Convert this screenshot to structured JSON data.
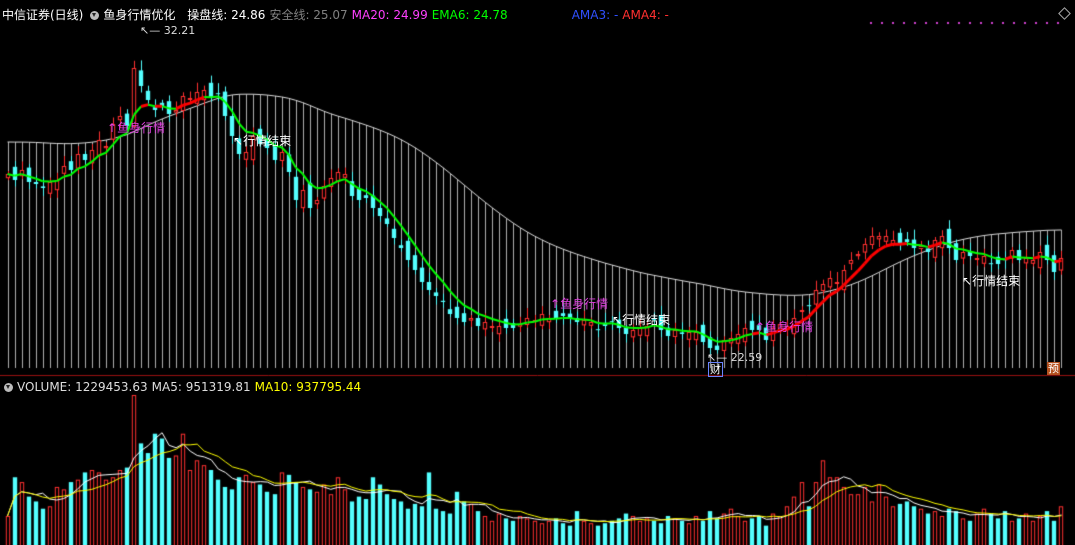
{
  "header": {
    "stock_name": "中信证券(日线)",
    "indicator_name": "鱼身行情优化",
    "items": [
      {
        "label": "操盘线: 24.86",
        "color": "#ffffff"
      },
      {
        "label": "安全线: 25.07",
        "color": "#808080"
      },
      {
        "label": "MA20: 24.99",
        "color": "#ff40ff"
      },
      {
        "label": "EMA6: 24.78",
        "color": "#00ff00"
      },
      {
        "label": "AMA3: -",
        "color": "#3050ff"
      },
      {
        "label": "AMA4: -",
        "color": "#ff3030"
      }
    ]
  },
  "volume_header": {
    "title": "VOLUME: 1229453.63",
    "ma5": "MA5: 951319.81",
    "ma10": "MA10: 937795.44"
  },
  "annotations": {
    "high_price": "32.21",
    "low_price": "22.59",
    "fish_start_1": "鱼身行情",
    "fish_end_1": "行情结束",
    "fish_start_2": "鱼身行情",
    "fish_end_2": "行情结束",
    "fish_start_3": "鱼身行情",
    "fish_end_3": "行情结束",
    "badge_cai": "财",
    "badge_yu": "预"
  },
  "colors": {
    "background": "#000000",
    "up": "#ff3030",
    "down": "#54ffff",
    "ema_line": "#00ff00",
    "fish_line": "#ff0000",
    "safety_hist": "#b0b0b0",
    "divider": "#9a1010",
    "ma5": "#ffffff",
    "ma10": "#ffff00"
  },
  "chart_data": {
    "type": "candlestick",
    "title": "中信证券(日线)",
    "close": [
      25.7,
      25.4,
      25.9,
      25.3,
      25.2,
      25.0,
      25.3,
      25.4,
      26.1,
      25.9,
      26.7,
      26.4,
      26.9,
      27.4,
      27.1,
      28.2,
      28.6,
      28.1,
      31.0,
      30.1,
      29.4,
      28.9,
      29.1,
      28.7,
      28.9,
      29.6,
      29.5,
      29.8,
      29.9,
      29.5,
      29.7,
      28.6,
      27.6,
      26.7,
      26.8,
      27.6,
      27.2,
      27.0,
      26.4,
      26.8,
      25.8,
      24.4,
      24.9,
      24.0,
      24.4,
      25.1,
      25.5,
      25.8,
      25.7,
      24.6,
      24.4,
      24.5,
      24.0,
      23.6,
      23.2,
      22.5,
      22.0,
      21.4,
      20.9,
      20.3,
      19.9,
      19.6,
      19.3,
      18.7,
      18.5,
      18.3,
      18.5,
      18.1,
      18.3,
      18.1,
      18.1,
      18.0,
      18.0,
      18.2,
      18.5,
      18.4,
      18.7,
      18.5,
      18.5,
      18.6,
      18.5,
      18.3,
      18.4,
      18.3,
      17.9,
      18.1,
      18.3,
      18.0,
      17.7,
      17.9,
      18.0,
      18.1,
      18.4,
      17.9,
      17.6,
      17.9,
      17.7,
      17.8,
      17.8,
      17.3,
      17.0,
      16.9,
      17.4,
      17.5,
      17.7,
      18.0,
      17.9,
      17.9,
      17.4,
      18.0,
      18.2,
      18.1,
      18.5,
      18.9,
      19.1,
      19.9,
      20.2,
      20.5,
      20.3,
      20.9,
      21.4,
      21.7,
      22.2,
      22.6,
      22.6,
      22.6,
      22.4,
      22.2,
      22.3,
      22.0,
      22.1,
      21.8,
      22.4,
      22.6,
      22.0,
      21.4,
      21.8,
      21.6,
      21.5,
      21.6,
      21.2,
      21.2,
      21.4,
      21.9,
      21.4,
      21.5,
      21.4,
      21.8,
      21.4,
      20.8,
      21.5
    ],
    "volume": [
      120,
      280,
      260,
      200,
      180,
      150,
      160,
      240,
      230,
      260,
      270,
      300,
      310,
      300,
      270,
      280,
      310,
      320,
      620,
      420,
      380,
      460,
      440,
      360,
      370,
      460,
      310,
      350,
      330,
      310,
      270,
      240,
      230,
      280,
      290,
      260,
      250,
      220,
      210,
      300,
      290,
      260,
      240,
      230,
      220,
      250,
      210,
      280,
      230,
      180,
      200,
      190,
      280,
      250,
      210,
      190,
      180,
      150,
      170,
      160,
      300,
      150,
      140,
      130,
      220,
      180,
      170,
      140,
      120,
      100,
      130,
      110,
      100,
      120,
      110,
      100,
      90,
      100,
      110,
      90,
      80,
      140,
      100,
      90,
      80,
      90,
      100,
      110,
      130,
      120,
      100,
      110,
      100,
      90,
      120,
      110,
      100,
      90,
      120,
      100,
      140,
      110,
      130,
      150,
      120,
      100,
      110,
      120,
      80,
      130,
      120,
      160,
      200,
      260,
      160,
      260,
      350,
      280,
      280,
      240,
      210,
      210,
      240,
      180,
      250,
      200,
      160,
      170,
      180,
      160,
      150,
      130,
      140,
      120,
      150,
      140,
      110,
      100,
      130,
      150,
      130,
      110,
      140,
      100,
      110,
      130,
      100,
      120,
      140,
      100,
      160
    ],
    "ema_color": "#00ff00",
    "ylim": [
      16.0,
      33.0
    ]
  }
}
